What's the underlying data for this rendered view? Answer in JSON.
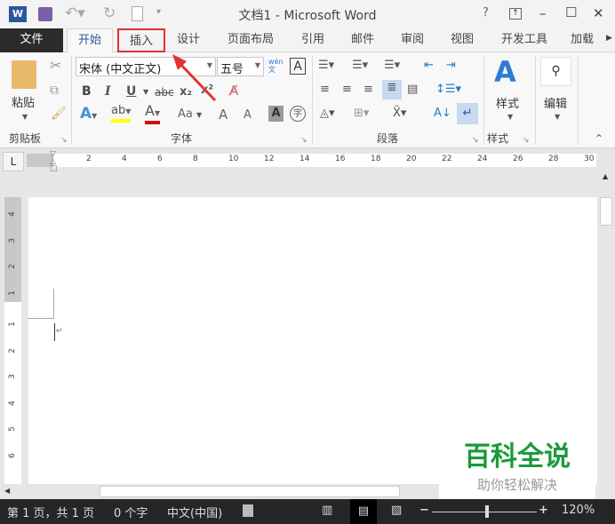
{
  "title": "文档1 - Microsoft Word",
  "quick_access": {
    "help": "?",
    "minimize": "–",
    "maximize": "☐",
    "close": "✕"
  },
  "tabs": [
    {
      "label": "文件"
    },
    {
      "label": "开始"
    },
    {
      "label": "插入"
    },
    {
      "label": "设计"
    },
    {
      "label": "页面布局"
    },
    {
      "label": "引用"
    },
    {
      "label": "邮件"
    },
    {
      "label": "审阅"
    },
    {
      "label": "视图"
    },
    {
      "label": "开发工具"
    },
    {
      "label": "加载"
    }
  ],
  "ribbon": {
    "clipboard": {
      "paste": "粘贴",
      "label": "剪贴板"
    },
    "font": {
      "font_name": "宋体 (中文正文)",
      "font_size": "五号",
      "label": "字体",
      "bold": "B",
      "italic": "I",
      "underline": "U",
      "strike": "abc",
      "sub": "x₂",
      "sup": "x²",
      "aa": "Aa",
      "grow": "A",
      "shrink": "A",
      "phonetic": "wén文",
      "border_char": "A",
      "shade_char": "A",
      "enclose": "字"
    },
    "paragraph": {
      "label": "段落"
    },
    "styles": {
      "button": "样式",
      "label": "样式"
    },
    "editing": {
      "button": "编辑"
    }
  },
  "ruler": {
    "tab_selector": "L",
    "ticks": [
      "2",
      "4",
      "6",
      "8",
      "10",
      "12",
      "14",
      "16",
      "18",
      "20",
      "22",
      "24",
      "26",
      "28",
      "30"
    ],
    "vticks": [
      "4",
      "3",
      "2",
      "1",
      "1",
      "2",
      "3",
      "4",
      "5",
      "6"
    ]
  },
  "status": {
    "page": "第 1 页，共 1 页",
    "words": "0 个字",
    "language": "中文(中国)",
    "zoom": "120%",
    "zoom_level": 120
  },
  "watermark": {
    "title": "百科全说",
    "subtitle": "助你轻松解决"
  },
  "colors": {
    "highlight_tab_border": "#e03030",
    "arrow": "#e03535",
    "accent": "#2b579a",
    "watermark": "#1a9a3a"
  }
}
